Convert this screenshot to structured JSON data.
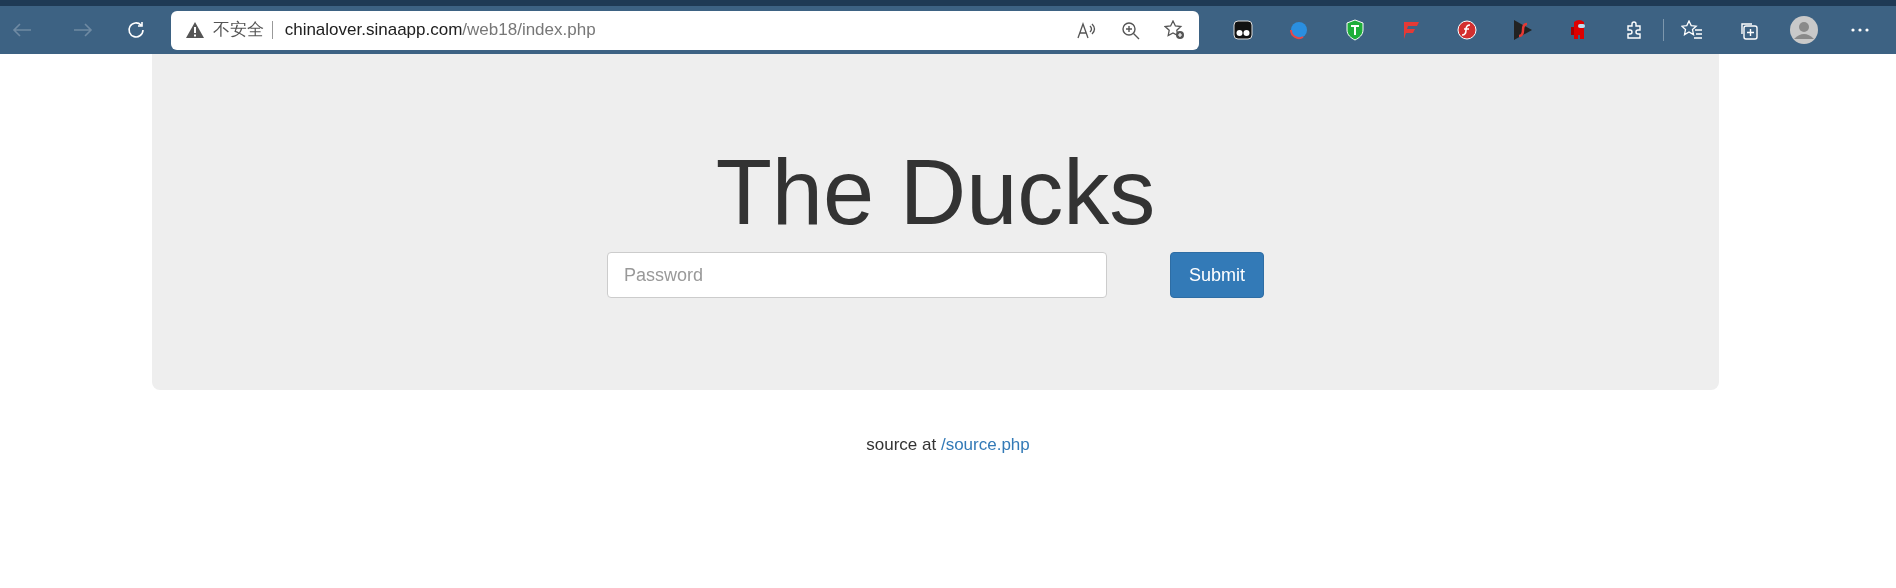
{
  "browser": {
    "security_label": "不安全",
    "url_host": "chinalover.sinaapp.com",
    "url_path": "/web18/index.php"
  },
  "page": {
    "title": "The Ducks",
    "password": {
      "placeholder": "Password"
    },
    "submit": "Submit",
    "footer": {
      "text": "source at",
      "link": "/source.php"
    }
  }
}
